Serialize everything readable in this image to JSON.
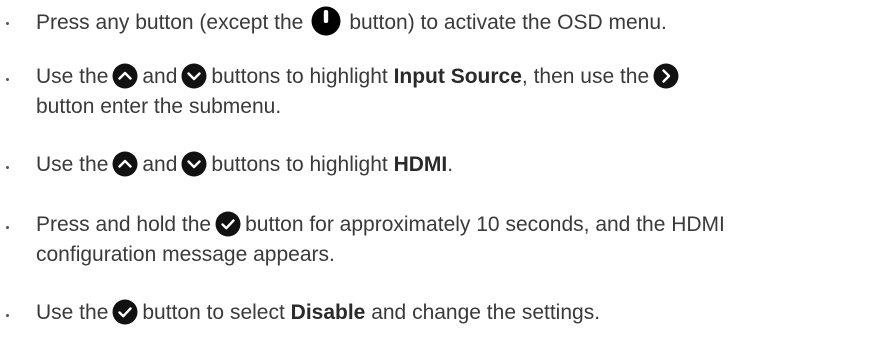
{
  "steps": [
    {
      "pre": "Press any button (except the",
      "icon": "power-icon",
      "post": "button) to activate the OSD menu."
    },
    {
      "pre": "Use the",
      "icon1": "up-button-icon",
      "mid": "and",
      "icon2": "down-button-icon",
      "mid2": "buttons to highlight",
      "bold": "Input Source",
      "mid3": ", then use the",
      "icon3": "right-button-icon",
      "line2": "button enter the submenu."
    },
    {
      "pre": "Use the",
      "icon1": "up-button-icon",
      "mid": "and",
      "icon2": "down-button-icon",
      "mid2": "buttons to highlight",
      "bold": "HDMI",
      "post": "."
    },
    {
      "pre": "Press and hold the",
      "icon": "check-button-icon",
      "post": "button for approximately 10 seconds, and the HDMI",
      "line2": "configuration message appears."
    },
    {
      "pre": "Use the",
      "icon": "check-button-icon",
      "mid": "button to select",
      "bold": "Disable",
      "post": "and change the settings."
    }
  ]
}
